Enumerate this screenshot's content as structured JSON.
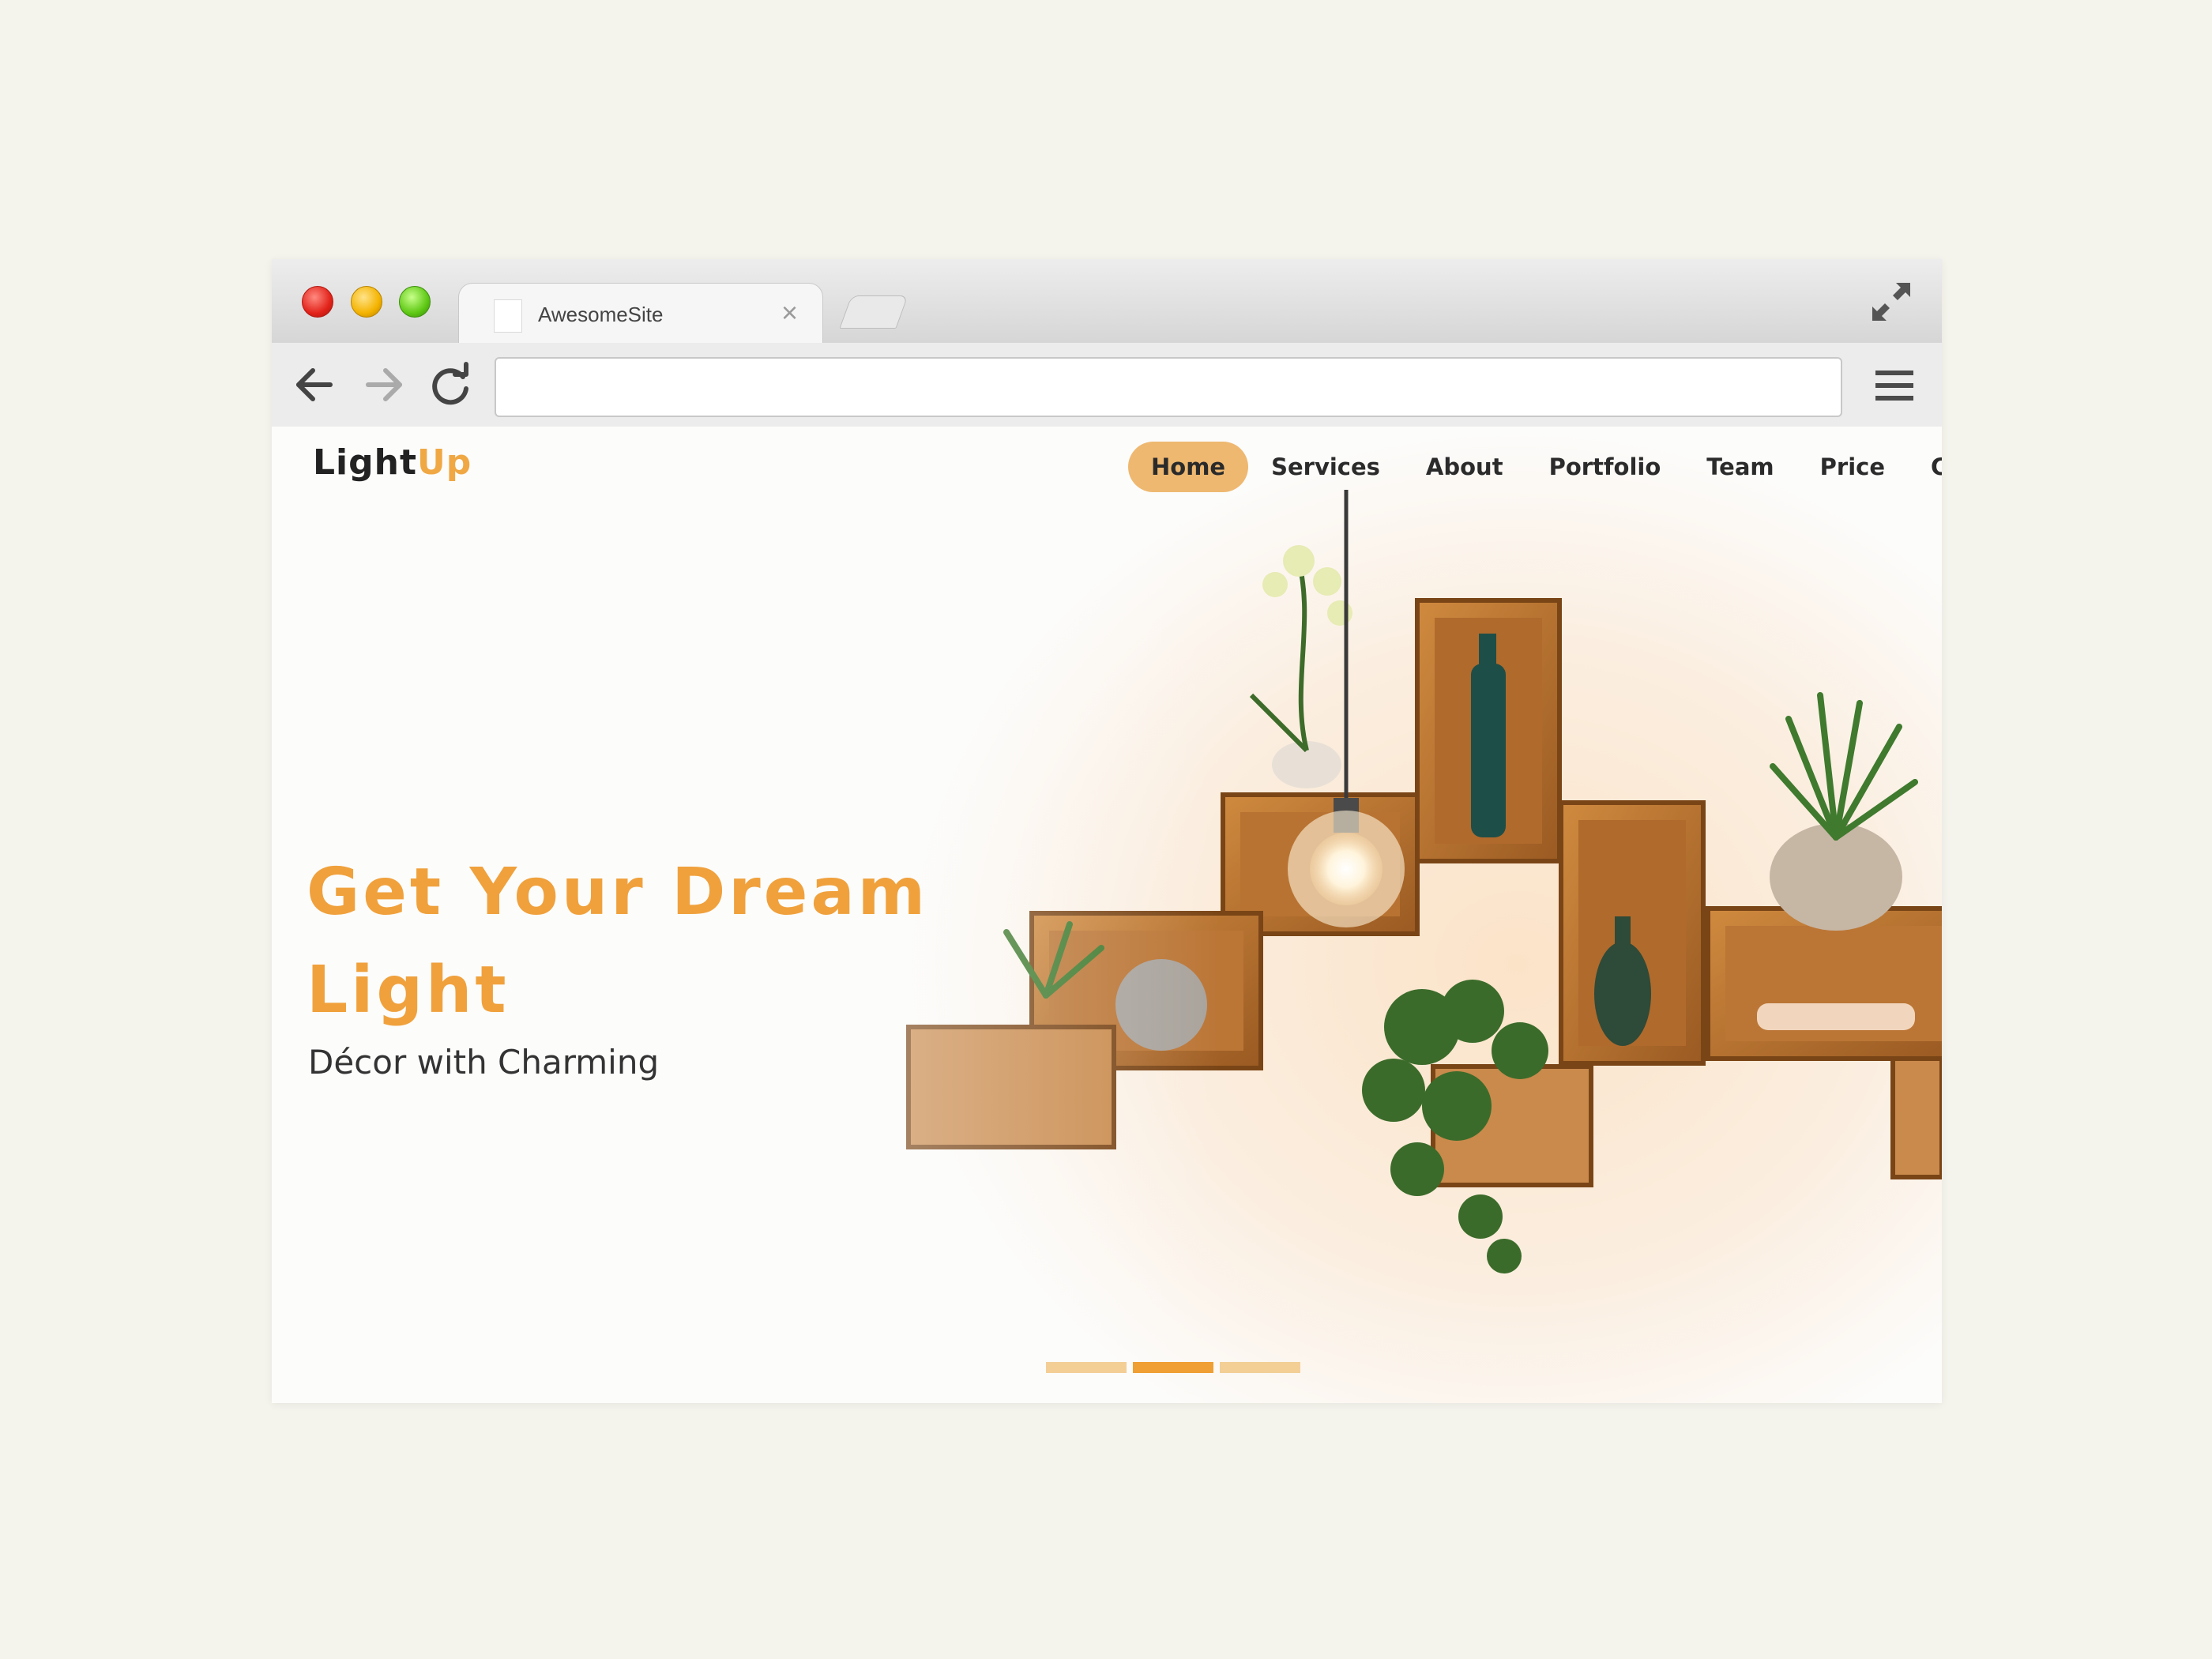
{
  "browser": {
    "tab_title": "AwesomeSite",
    "tab_close": "×",
    "url": "",
    "colors": {
      "close": "#e2231a",
      "minimize": "#f4b300",
      "maximize": "#5ec814"
    }
  },
  "site": {
    "logo_main": "Light",
    "logo_accent": "Up",
    "accent_color": "#f0a13c",
    "nav": [
      {
        "label": "Home",
        "active": true
      },
      {
        "label": "Services"
      },
      {
        "label": "About"
      },
      {
        "label": "Portfolio"
      },
      {
        "label": "Team"
      },
      {
        "label": "Price"
      },
      {
        "label": "Co"
      }
    ]
  },
  "hero": {
    "title_line1": "Get Your Dream",
    "title_line2": "Light",
    "subtitle": "Décor with Charming",
    "slides_total": 3,
    "slide_active_index": 1
  }
}
